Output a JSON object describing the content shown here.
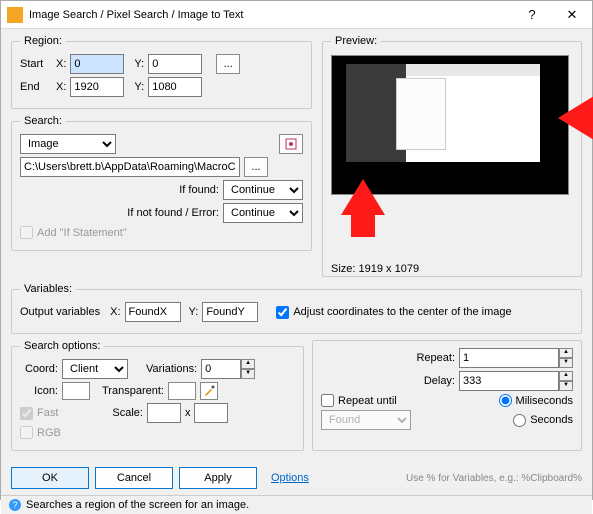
{
  "titlebar": {
    "title": "Image Search / Pixel Search / Image to Text"
  },
  "region": {
    "legend": "Region:",
    "start_label": "Start",
    "end_label": "End",
    "x_label": "X:",
    "y_label": "Y:",
    "start_x": "0",
    "start_y": "0",
    "end_x": "1920",
    "end_y": "1080",
    "browse": "..."
  },
  "search": {
    "legend": "Search:",
    "type": "Image",
    "path": "C:\\Users\\brett.b\\AppData\\Roaming\\MacroCrea",
    "browse": "...",
    "if_found_label": "If found:",
    "if_found": "Continue",
    "if_not_label": "If not found / Error:",
    "if_not": "Continue",
    "add_if": "Add \"If Statement\""
  },
  "preview": {
    "legend": "Preview:",
    "size_label": "Size: 1919 x 1079"
  },
  "variables": {
    "legend": "Variables:",
    "output_label": "Output variables",
    "x_label": "X:",
    "y_label": "Y:",
    "found_x": "FoundX",
    "found_y": "FoundY",
    "adjust": "Adjust coordinates to the center of the image"
  },
  "options": {
    "legend": "Search options:",
    "coord_label": "Coord:",
    "coord": "Client",
    "variations_label": "Variations:",
    "variations": "0",
    "icon_label": "Icon:",
    "transparent_label": "Transparent:",
    "fast": "Fast",
    "rgb": "RGB",
    "scale_label": "Scale:",
    "scale_x": "x"
  },
  "repeat": {
    "repeat_label": "Repeat:",
    "repeat": "1",
    "delay_label": "Delay:",
    "delay": "333",
    "until_label": "Repeat until",
    "until_value": "Found",
    "ms": "Miliseconds",
    "sec": "Seconds"
  },
  "footer": {
    "ok": "OK",
    "cancel": "Cancel",
    "apply": "Apply",
    "options": "Options",
    "hint": "Use % for Variables, e.g.: %Clipboard%"
  },
  "status": {
    "text": "Searches a region of the screen for an image."
  }
}
